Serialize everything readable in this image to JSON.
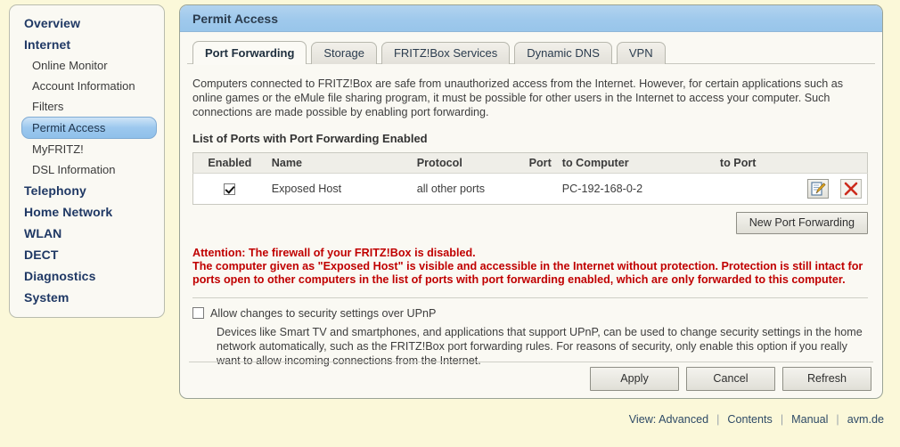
{
  "sidebar": {
    "items": [
      {
        "label": "Overview",
        "level": "top",
        "selected": false
      },
      {
        "label": "Internet",
        "level": "top",
        "selected": false
      },
      {
        "label": "Online Monitor",
        "level": "sub",
        "selected": false
      },
      {
        "label": "Account Information",
        "level": "sub",
        "selected": false
      },
      {
        "label": "Filters",
        "level": "sub",
        "selected": false
      },
      {
        "label": "Permit Access",
        "level": "sub",
        "selected": true
      },
      {
        "label": "MyFRITZ!",
        "level": "sub",
        "selected": false
      },
      {
        "label": "DSL Information",
        "level": "sub",
        "selected": false
      },
      {
        "label": "Telephony",
        "level": "top",
        "selected": false
      },
      {
        "label": "Home Network",
        "level": "top",
        "selected": false
      },
      {
        "label": "WLAN",
        "level": "top",
        "selected": false
      },
      {
        "label": "DECT",
        "level": "top",
        "selected": false
      },
      {
        "label": "Diagnostics",
        "level": "top",
        "selected": false
      },
      {
        "label": "System",
        "level": "top",
        "selected": false
      }
    ]
  },
  "panel": {
    "title": "Permit Access",
    "tabs": [
      {
        "label": "Port Forwarding",
        "active": true
      },
      {
        "label": "Storage",
        "active": false
      },
      {
        "label": "FRITZ!Box Services",
        "active": false
      },
      {
        "label": "Dynamic DNS",
        "active": false
      },
      {
        "label": "VPN",
        "active": false
      }
    ],
    "intro": "Computers connected to FRITZ!Box are safe from unauthorized access from the Internet. However, for certain applications such as online games or the eMule file sharing program, it must be possible for other users in the Internet to access your computer. Such connections are made possible by enabling port forwarding.",
    "list_title": "List of Ports with Port Forwarding Enabled",
    "table": {
      "headers": [
        "Enabled",
        "Name",
        "Protocol",
        "Port",
        "to Computer",
        "to Port",
        ""
      ],
      "rows": [
        {
          "enabled": true,
          "name": "Exposed Host",
          "protocol": "all other ports",
          "port": "",
          "to_computer": "PC-192-168-0-2",
          "to_port": ""
        }
      ]
    },
    "new_forwarding_label": "New Port Forwarding",
    "warning": {
      "line1": "Attention: The firewall of your FRITZ!Box is disabled.",
      "line2": "The computer given as \"Exposed Host\" is visible and accessible in the Internet without protection. Protection is still intact for ports open to other computers in the list of ports with port forwarding enabled, which are only forwarded to this computer."
    },
    "upnp": {
      "checked": false,
      "label": "Allow changes to security settings over UPnP",
      "description": "Devices like Smart TV and smartphones, and applications that support UPnP, can be used to change security settings in the home network automatically, such as the FRITZ!Box port forwarding rules. For reasons of security, only enable this option if you really want to allow incoming connections from the Internet."
    },
    "buttons": {
      "apply": "Apply",
      "cancel": "Cancel",
      "refresh": "Refresh"
    }
  },
  "footer": {
    "view": "View: Advanced",
    "contents": "Contents",
    "manual": "Manual",
    "site": "avm.de",
    "separator": "|"
  },
  "colors": {
    "page_bg": "#fbf8d9",
    "panel_bg": "#faf9f3",
    "header_blue": "#9fc9ec",
    "warning_red": "#c00000",
    "nav_heading": "#1f3864",
    "selected_nav": "#9cc8ee"
  }
}
